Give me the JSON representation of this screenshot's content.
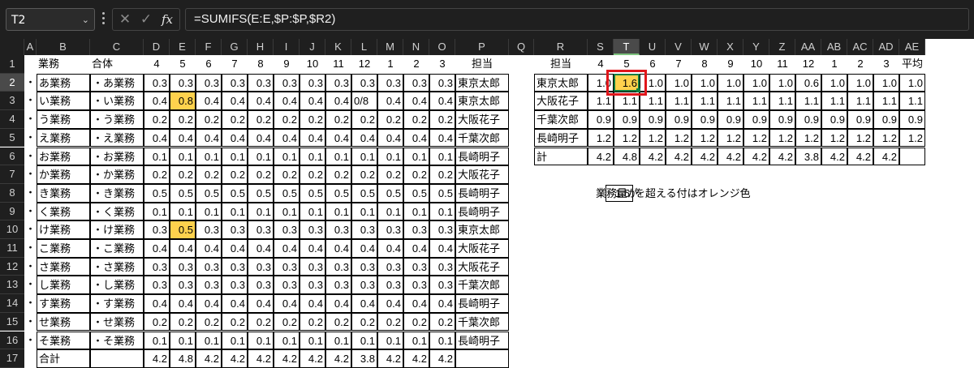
{
  "formula_bar": {
    "name_box": "T2",
    "formula": "=SUMIFS(E:E,$P:$P,$R2)"
  },
  "colors": {
    "highlight": "#ffd24d",
    "selection_box": "#e0161b",
    "selected_cell_border": "#107c41"
  },
  "columns": [
    "A",
    "B",
    "C",
    "D",
    "E",
    "F",
    "G",
    "H",
    "I",
    "J",
    "K",
    "L",
    "M",
    "N",
    "O",
    "P",
    "Q",
    "R",
    "S",
    "T",
    "U",
    "V",
    "W",
    "X",
    "Y",
    "Z",
    "AA",
    "AB",
    "AC",
    "AD",
    "AE"
  ],
  "selected_column": "T",
  "rows": [
    "1",
    "2",
    "3",
    "4",
    "5",
    "6",
    "7",
    "8",
    "9",
    "10",
    "11",
    "12",
    "13",
    "14",
    "15",
    "16",
    "17"
  ],
  "selected_row": "2",
  "left_table": {
    "header": {
      "b": "業務",
      "c": "合体",
      "months": [
        "4",
        "5",
        "6",
        "7",
        "8",
        "9",
        "10",
        "11",
        "12",
        "1",
        "2",
        "3"
      ],
      "p": "担当"
    },
    "rows": [
      {
        "a": "・",
        "b": "あ業務",
        "c": "・あ業務",
        "vals": [
          "0.3",
          "0.3",
          "0.3",
          "0.3",
          "0.3",
          "0.3",
          "0.3",
          "0.3",
          "0.3",
          "0.3",
          "0.3",
          "0.3"
        ],
        "p": "東京太郎"
      },
      {
        "a": "・",
        "b": "い業務",
        "c": "・い業務",
        "vals": [
          "0.4",
          "0.8",
          "0.4",
          "0.4",
          "0.4",
          "0.4",
          "0.4",
          "0.4",
          "0/8",
          "0.4",
          "0.4",
          "0.4"
        ],
        "p": "東京太郎"
      },
      {
        "a": "・",
        "b": "う業務",
        "c": "・う業務",
        "vals": [
          "0.2",
          "0.2",
          "0.2",
          "0.2",
          "0.2",
          "0.2",
          "0.2",
          "0.2",
          "0.2",
          "0.2",
          "0.2",
          "0.2"
        ],
        "p": "大阪花子"
      },
      {
        "a": "・",
        "b": "え業務",
        "c": "・え業務",
        "vals": [
          "0.4",
          "0.4",
          "0.4",
          "0.4",
          "0.4",
          "0.4",
          "0.4",
          "0.4",
          "0.4",
          "0.4",
          "0.4",
          "0.4"
        ],
        "p": "千葉次郎"
      },
      {
        "a": "・",
        "b": "お業務",
        "c": "・お業務",
        "vals": [
          "0.1",
          "0.1",
          "0.1",
          "0.1",
          "0.1",
          "0.1",
          "0.1",
          "0.1",
          "0.1",
          "0.1",
          "0.1",
          "0.1"
        ],
        "p": "長崎明子"
      },
      {
        "a": "・",
        "b": "か業務",
        "c": "・か業務",
        "vals": [
          "0.2",
          "0.2",
          "0.2",
          "0.2",
          "0.2",
          "0.2",
          "0.2",
          "0.2",
          "0.2",
          "0.2",
          "0.2",
          "0.2"
        ],
        "p": "大阪花子"
      },
      {
        "a": "・",
        "b": "き業務",
        "c": "・き業務",
        "vals": [
          "0.5",
          "0.5",
          "0.5",
          "0.5",
          "0.5",
          "0.5",
          "0.5",
          "0.5",
          "0.5",
          "0.5",
          "0.5",
          "0.5"
        ],
        "p": "長崎明子"
      },
      {
        "a": "・",
        "b": "く業務",
        "c": "・く業務",
        "vals": [
          "0.1",
          "0.1",
          "0.1",
          "0.1",
          "0.1",
          "0.1",
          "0.1",
          "0.1",
          "0.1",
          "0.1",
          "0.1",
          "0.1"
        ],
        "p": "長崎明子"
      },
      {
        "a": "・",
        "b": "け業務",
        "c": "・け業務",
        "vals": [
          "0.3",
          "0.5",
          "0.3",
          "0.3",
          "0.3",
          "0.3",
          "0.3",
          "0.3",
          "0.3",
          "0.3",
          "0.3",
          "0.3"
        ],
        "p": "東京太郎"
      },
      {
        "a": "・",
        "b": "こ業務",
        "c": "・こ業務",
        "vals": [
          "0.4",
          "0.4",
          "0.4",
          "0.4",
          "0.4",
          "0.4",
          "0.4",
          "0.4",
          "0.4",
          "0.4",
          "0.4",
          "0.4"
        ],
        "p": "大阪花子"
      },
      {
        "a": "・",
        "b": "さ業務",
        "c": "・さ業務",
        "vals": [
          "0.3",
          "0.3",
          "0.3",
          "0.3",
          "0.3",
          "0.3",
          "0.3",
          "0.3",
          "0.3",
          "0.3",
          "0.3",
          "0.3"
        ],
        "p": "大阪花子"
      },
      {
        "a": "・",
        "b": "し業務",
        "c": "・し業務",
        "vals": [
          "0.3",
          "0.3",
          "0.3",
          "0.3",
          "0.3",
          "0.3",
          "0.3",
          "0.3",
          "0.3",
          "0.3",
          "0.3",
          "0.3"
        ],
        "p": "千葉次郎"
      },
      {
        "a": "・",
        "b": "す業務",
        "c": "・す業務",
        "vals": [
          "0.4",
          "0.4",
          "0.4",
          "0.4",
          "0.4",
          "0.4",
          "0.4",
          "0.4",
          "0.4",
          "0.4",
          "0.4",
          "0.4"
        ],
        "p": "長崎明子"
      },
      {
        "a": "・",
        "b": "せ業務",
        "c": "・せ業務",
        "vals": [
          "0.2",
          "0.2",
          "0.2",
          "0.2",
          "0.2",
          "0.2",
          "0.2",
          "0.2",
          "0.2",
          "0.2",
          "0.2",
          "0.2"
        ],
        "p": "千葉次郎"
      },
      {
        "a": "・",
        "b": "そ業務",
        "c": "・そ業務",
        "vals": [
          "0.1",
          "0.1",
          "0.1",
          "0.1",
          "0.1",
          "0.1",
          "0.1",
          "0.1",
          "0.1",
          "0.1",
          "0.1",
          "0.1"
        ],
        "p": "長崎明子"
      }
    ],
    "total": {
      "b": "合計",
      "vals": [
        "4.2",
        "4.8",
        "4.2",
        "4.2",
        "4.2",
        "4.2",
        "4.2",
        "4.2",
        "3.8",
        "4.2",
        "4.2",
        "4.2"
      ]
    },
    "highlighted": [
      [
        1,
        1
      ],
      [
        8,
        1
      ]
    ]
  },
  "right_table": {
    "header": {
      "r": "担当",
      "months": [
        "4",
        "5",
        "6",
        "7",
        "8",
        "9",
        "10",
        "11",
        "12",
        "1",
        "2",
        "3"
      ],
      "avg": "平均"
    },
    "rows": [
      {
        "name": "東京太郎",
        "vals": [
          "1.0",
          "1.6",
          "1.0",
          "1.0",
          "1.0",
          "1.0",
          "1.0",
          "1.0",
          "0.6",
          "1.0",
          "1.0",
          "1.0"
        ],
        "avg": "1.0"
      },
      {
        "name": "大阪花子",
        "vals": [
          "1.1",
          "1.1",
          "1.1",
          "1.1",
          "1.1",
          "1.1",
          "1.1",
          "1.1",
          "1.1",
          "1.1",
          "1.1",
          "1.1"
        ],
        "avg": "1.1"
      },
      {
        "name": "千葉次郎",
        "vals": [
          "0.9",
          "0.9",
          "0.9",
          "0.9",
          "0.9",
          "0.9",
          "0.9",
          "0.9",
          "0.9",
          "0.9",
          "0.9",
          "0.9"
        ],
        "avg": "0.9"
      },
      {
        "name": "長崎明子",
        "vals": [
          "1.2",
          "1.2",
          "1.2",
          "1.2",
          "1.2",
          "1.2",
          "1.2",
          "1.2",
          "1.2",
          "1.2",
          "1.2",
          "1.2"
        ],
        "avg": "1.2"
      }
    ],
    "total": {
      "name": "計",
      "vals": [
        "4.2",
        "4.8",
        "4.2",
        "4.2",
        "4.2",
        "4.2",
        "4.2",
        "4.2",
        "3.8",
        "4.2",
        "4.2",
        "4.2"
      ]
    }
  },
  "threshold": {
    "before": "業務量が",
    "value": "1.5",
    "after": "を超える付はオレンジ色"
  }
}
